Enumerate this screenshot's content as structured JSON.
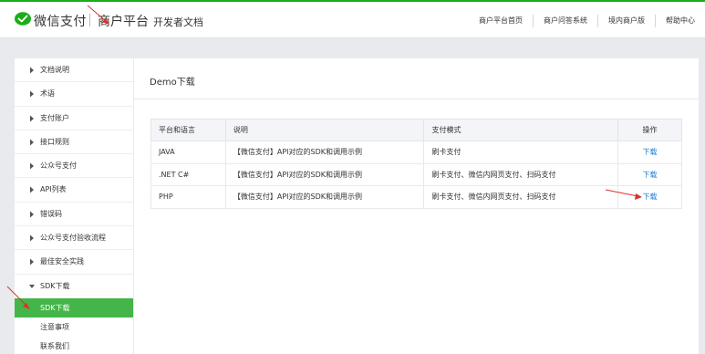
{
  "header": {
    "brand": "微信支付",
    "sub_brand": "商户平台",
    "doc_label": "开发者文档",
    "nav": [
      "商户平台首页",
      "商户问答系统",
      "境内商户版",
      "帮助中心"
    ],
    "accent_color": "#1aad19"
  },
  "sidebar": {
    "items": [
      {
        "label": "文档说明"
      },
      {
        "label": "术语"
      },
      {
        "label": "支付账户"
      },
      {
        "label": "接口规则"
      },
      {
        "label": "公众号支付"
      },
      {
        "label": "API列表"
      },
      {
        "label": "错误码"
      },
      {
        "label": "公众号支付验收流程"
      },
      {
        "label": "最佳安全实践"
      },
      {
        "label": "SDK下载"
      }
    ],
    "sub_items": [
      {
        "label": "SDK下载",
        "active": true
      },
      {
        "label": "注意事项",
        "active": false
      },
      {
        "label": "联系我们",
        "active": false
      }
    ],
    "active_color": "#44b549"
  },
  "main": {
    "title": "Demo下载",
    "table": {
      "headers": [
        "平台和语言",
        "说明",
        "支付模式",
        "操作"
      ],
      "rows": [
        {
          "platform": "JAVA",
          "desc": "【微信支付】API对应的SDK和调用示例",
          "mode": "刷卡支付",
          "action": "下载"
        },
        {
          "platform": ".NET C#",
          "desc": "【微信支付】API对应的SDK和调用示例",
          "mode": "刷卡支付、微信内网页支付、扫码支付",
          "action": "下载"
        },
        {
          "platform": "PHP",
          "desc": "【微信支付】API对应的SDK和调用示例",
          "mode": "刷卡支付、微信内网页支付、扫码支付",
          "action": "下载"
        }
      ]
    },
    "link_color": "#1f7bd1"
  },
  "annotations": {
    "arrow_color": "#e0302a"
  }
}
